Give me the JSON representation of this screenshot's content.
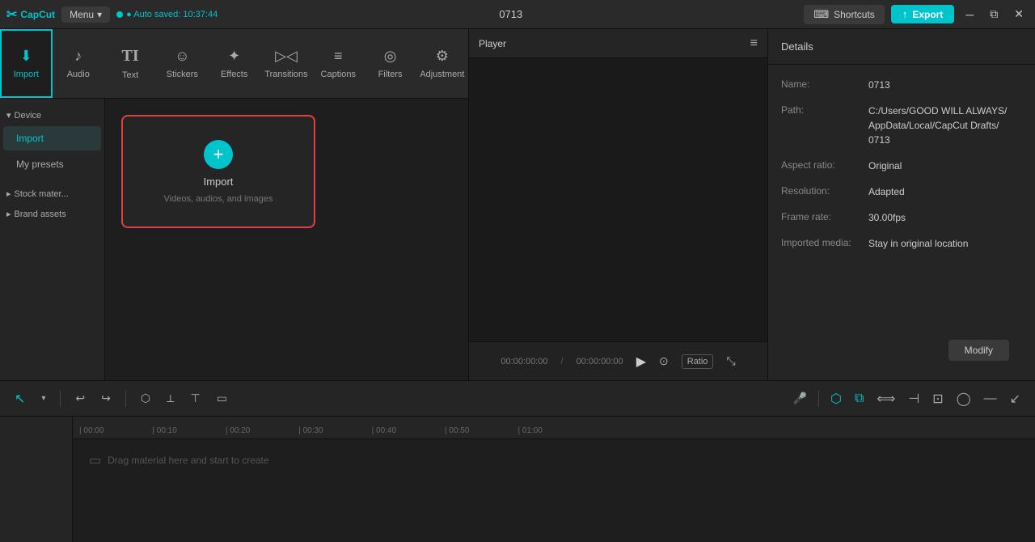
{
  "titlebar": {
    "logo": "CapCut",
    "menu_label": "Menu",
    "menu_arrow": "▾",
    "autosave": "● Auto saved: 10:37:44",
    "project_id": "0713",
    "shortcuts_label": "Shortcuts",
    "export_label": "Export"
  },
  "toolbar": {
    "items": [
      {
        "id": "import",
        "label": "Import",
        "icon": "⬇"
      },
      {
        "id": "audio",
        "label": "Audio",
        "icon": "♪"
      },
      {
        "id": "text",
        "label": "Text",
        "icon": "T"
      },
      {
        "id": "stickers",
        "label": "Stickers",
        "icon": "☺"
      },
      {
        "id": "effects",
        "label": "Effects",
        "icon": "✦"
      },
      {
        "id": "transitions",
        "label": "Transitions",
        "icon": "⟨⟩"
      },
      {
        "id": "captions",
        "label": "Captions",
        "icon": "≡"
      },
      {
        "id": "filters",
        "label": "Filters",
        "icon": "◎"
      },
      {
        "id": "adjustment",
        "label": "Adjustment",
        "icon": "⚙"
      }
    ]
  },
  "sidebar": {
    "groups": [
      {
        "header": "Device",
        "items": [
          {
            "id": "import",
            "label": "Import",
            "active": true
          },
          {
            "id": "my-presets",
            "label": "My presets"
          }
        ]
      },
      {
        "header": "Stock mater...",
        "items": []
      },
      {
        "header": "Brand assets",
        "items": []
      }
    ]
  },
  "import_area": {
    "button_icon": "+",
    "button_label": "Import",
    "button_sub": "Videos, audios, and images"
  },
  "player": {
    "title": "Player",
    "time_current": "00:00:00:00",
    "time_total": "00:00:00:00"
  },
  "details": {
    "title": "Details",
    "fields": [
      {
        "label": "Name:",
        "value": "0713"
      },
      {
        "label": "Path:",
        "value": "C:/Users/GOOD WILL ALWAYS/\nAppData/Local/CapCut Drafts/\n0713"
      },
      {
        "label": "Aspect ratio:",
        "value": "Original"
      },
      {
        "label": "Resolution:",
        "value": "Adapted"
      },
      {
        "label": "Frame rate:",
        "value": "30.00fps"
      },
      {
        "label": "Imported media:",
        "value": "Stay in original location"
      }
    ],
    "modify_label": "Modify"
  },
  "timeline": {
    "drag_hint": "Drag material here and start to create",
    "ruler_ticks": [
      "| 00:00",
      "| 00:10",
      "| 00:20",
      "| 00:30",
      "| 00:40",
      "| 00:50",
      "| 01:00"
    ]
  }
}
